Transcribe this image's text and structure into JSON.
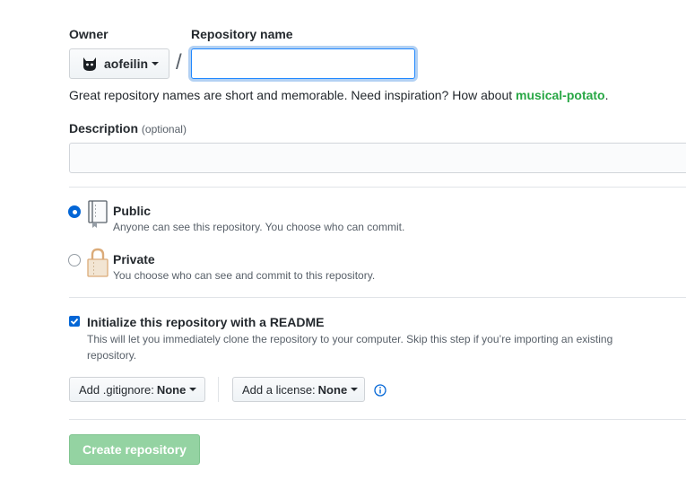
{
  "owner": {
    "label": "Owner",
    "name": "aofeilin"
  },
  "repo": {
    "label": "Repository name",
    "separator": "/",
    "value": ""
  },
  "hint": {
    "prefix": "Great repository names are short and memorable. Need inspiration? How about ",
    "suggestion": "musical-potato",
    "suffix": "."
  },
  "description": {
    "label": "Description",
    "optional": "(optional)",
    "value": ""
  },
  "visibility": {
    "public": {
      "title": "Public",
      "desc": "Anyone can see this repository. You choose who can commit.",
      "selected": true
    },
    "private": {
      "title": "Private",
      "desc": "You choose who can see and commit to this repository.",
      "selected": false
    }
  },
  "init": {
    "checked": true,
    "title": "Initialize this repository with a README",
    "desc_line1": "This will let you immediately clone the repository to your computer. Skip this step if you’re importing an existing",
    "desc_line2": "repository."
  },
  "gitignore": {
    "prefix": "Add .gitignore:",
    "value": "None"
  },
  "license": {
    "prefix": "Add a license:",
    "value": "None"
  },
  "submit": {
    "label": "Create repository"
  },
  "colors": {
    "accent": "#0366d6",
    "success_disabled": "#94d3a2",
    "suggestion": "#28a745"
  }
}
